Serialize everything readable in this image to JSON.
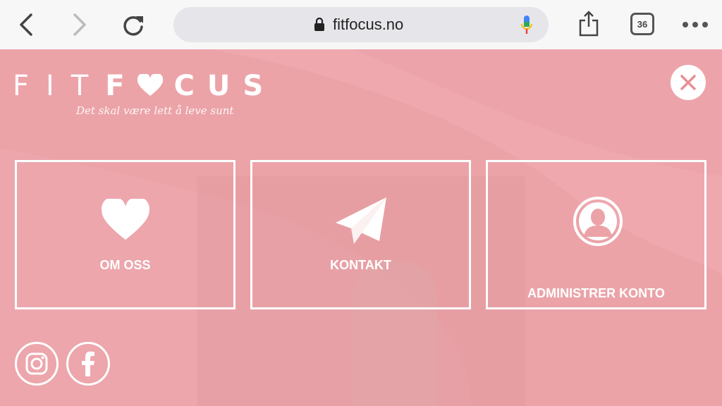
{
  "browser": {
    "url": "fitfocus.no",
    "tab_count": "36"
  },
  "logo": {
    "part_thin_1": "FIT",
    "part_bold_1": "F",
    "part_bold_2": "CUS",
    "tagline": "Det skal være lett å leve sunt"
  },
  "menu": {
    "tiles": [
      {
        "label": "OM OSS",
        "icon": "heart-icon"
      },
      {
        "label": "KONTAKT",
        "icon": "paper-plane-icon"
      },
      {
        "label": "ADMINISTRER KONTO",
        "icon": "user-avatar-icon"
      }
    ]
  },
  "social": {
    "instagram": "instagram-icon",
    "facebook": "facebook-icon"
  },
  "colors": {
    "overlay": "#eba3a8",
    "toolbar": "#f7f7f7",
    "accent": "#e88f95"
  }
}
